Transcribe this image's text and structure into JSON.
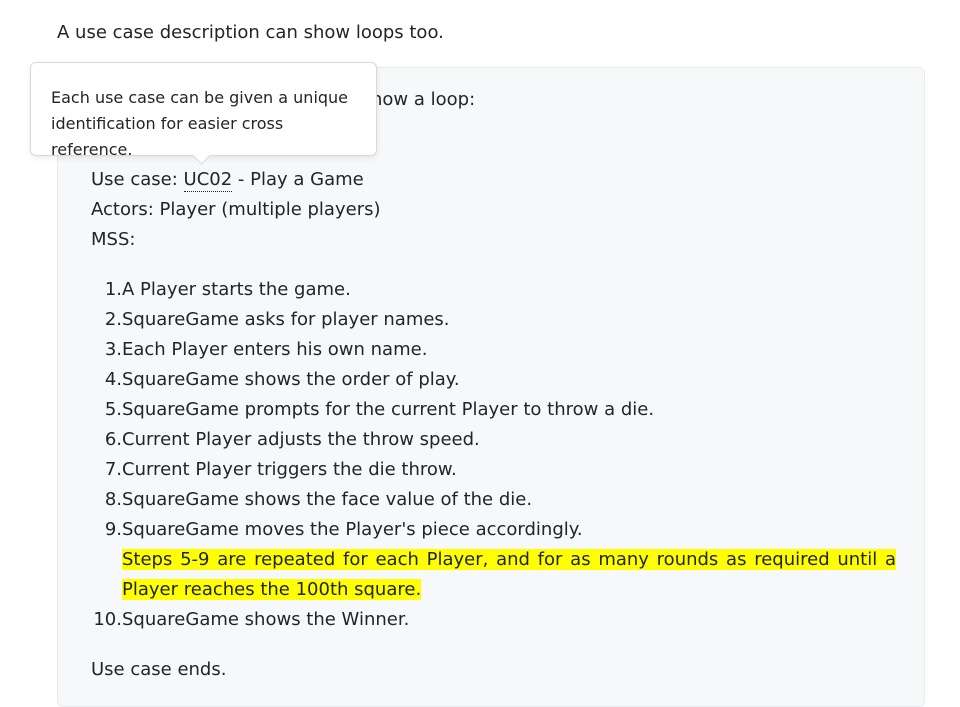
{
  "intro": "A use case description can show loops too.",
  "box": {
    "heading_tail": "how a loop:",
    "usecase_label": "Use case: ",
    "usecase_id": "UC02",
    "usecase_name": " - Play a Game",
    "actors": "Actors: Player (multiple players)",
    "mss": "MSS:",
    "steps": [
      "A Player starts the game.",
      "SquareGame asks for player names.",
      "Each Player enters his own name.",
      "SquareGame shows the order of play.",
      "SquareGame prompts for the current Player to throw a die.",
      "Current Player adjusts the throw speed.",
      "Current Player triggers the die throw.",
      "SquareGame shows the face value of the die.",
      "SquareGame moves the Player's piece accordingly.",
      "SquareGame shows the Winner."
    ],
    "step_numbers": [
      "1.",
      "2.",
      "3.",
      "4.",
      "5.",
      "6.",
      "7.",
      "8.",
      "9.",
      "10."
    ],
    "highlight": "Steps 5-9 are repeated for each Player, and for as many rounds as required until a Player reaches the 100th square.",
    "ending": "Use case ends."
  },
  "tooltip": {
    "text": "Each use case can be given a unique identification for easier cross reference."
  },
  "colors": {
    "highlight": "#ffff00",
    "box_bg": "#f7f8f9"
  }
}
